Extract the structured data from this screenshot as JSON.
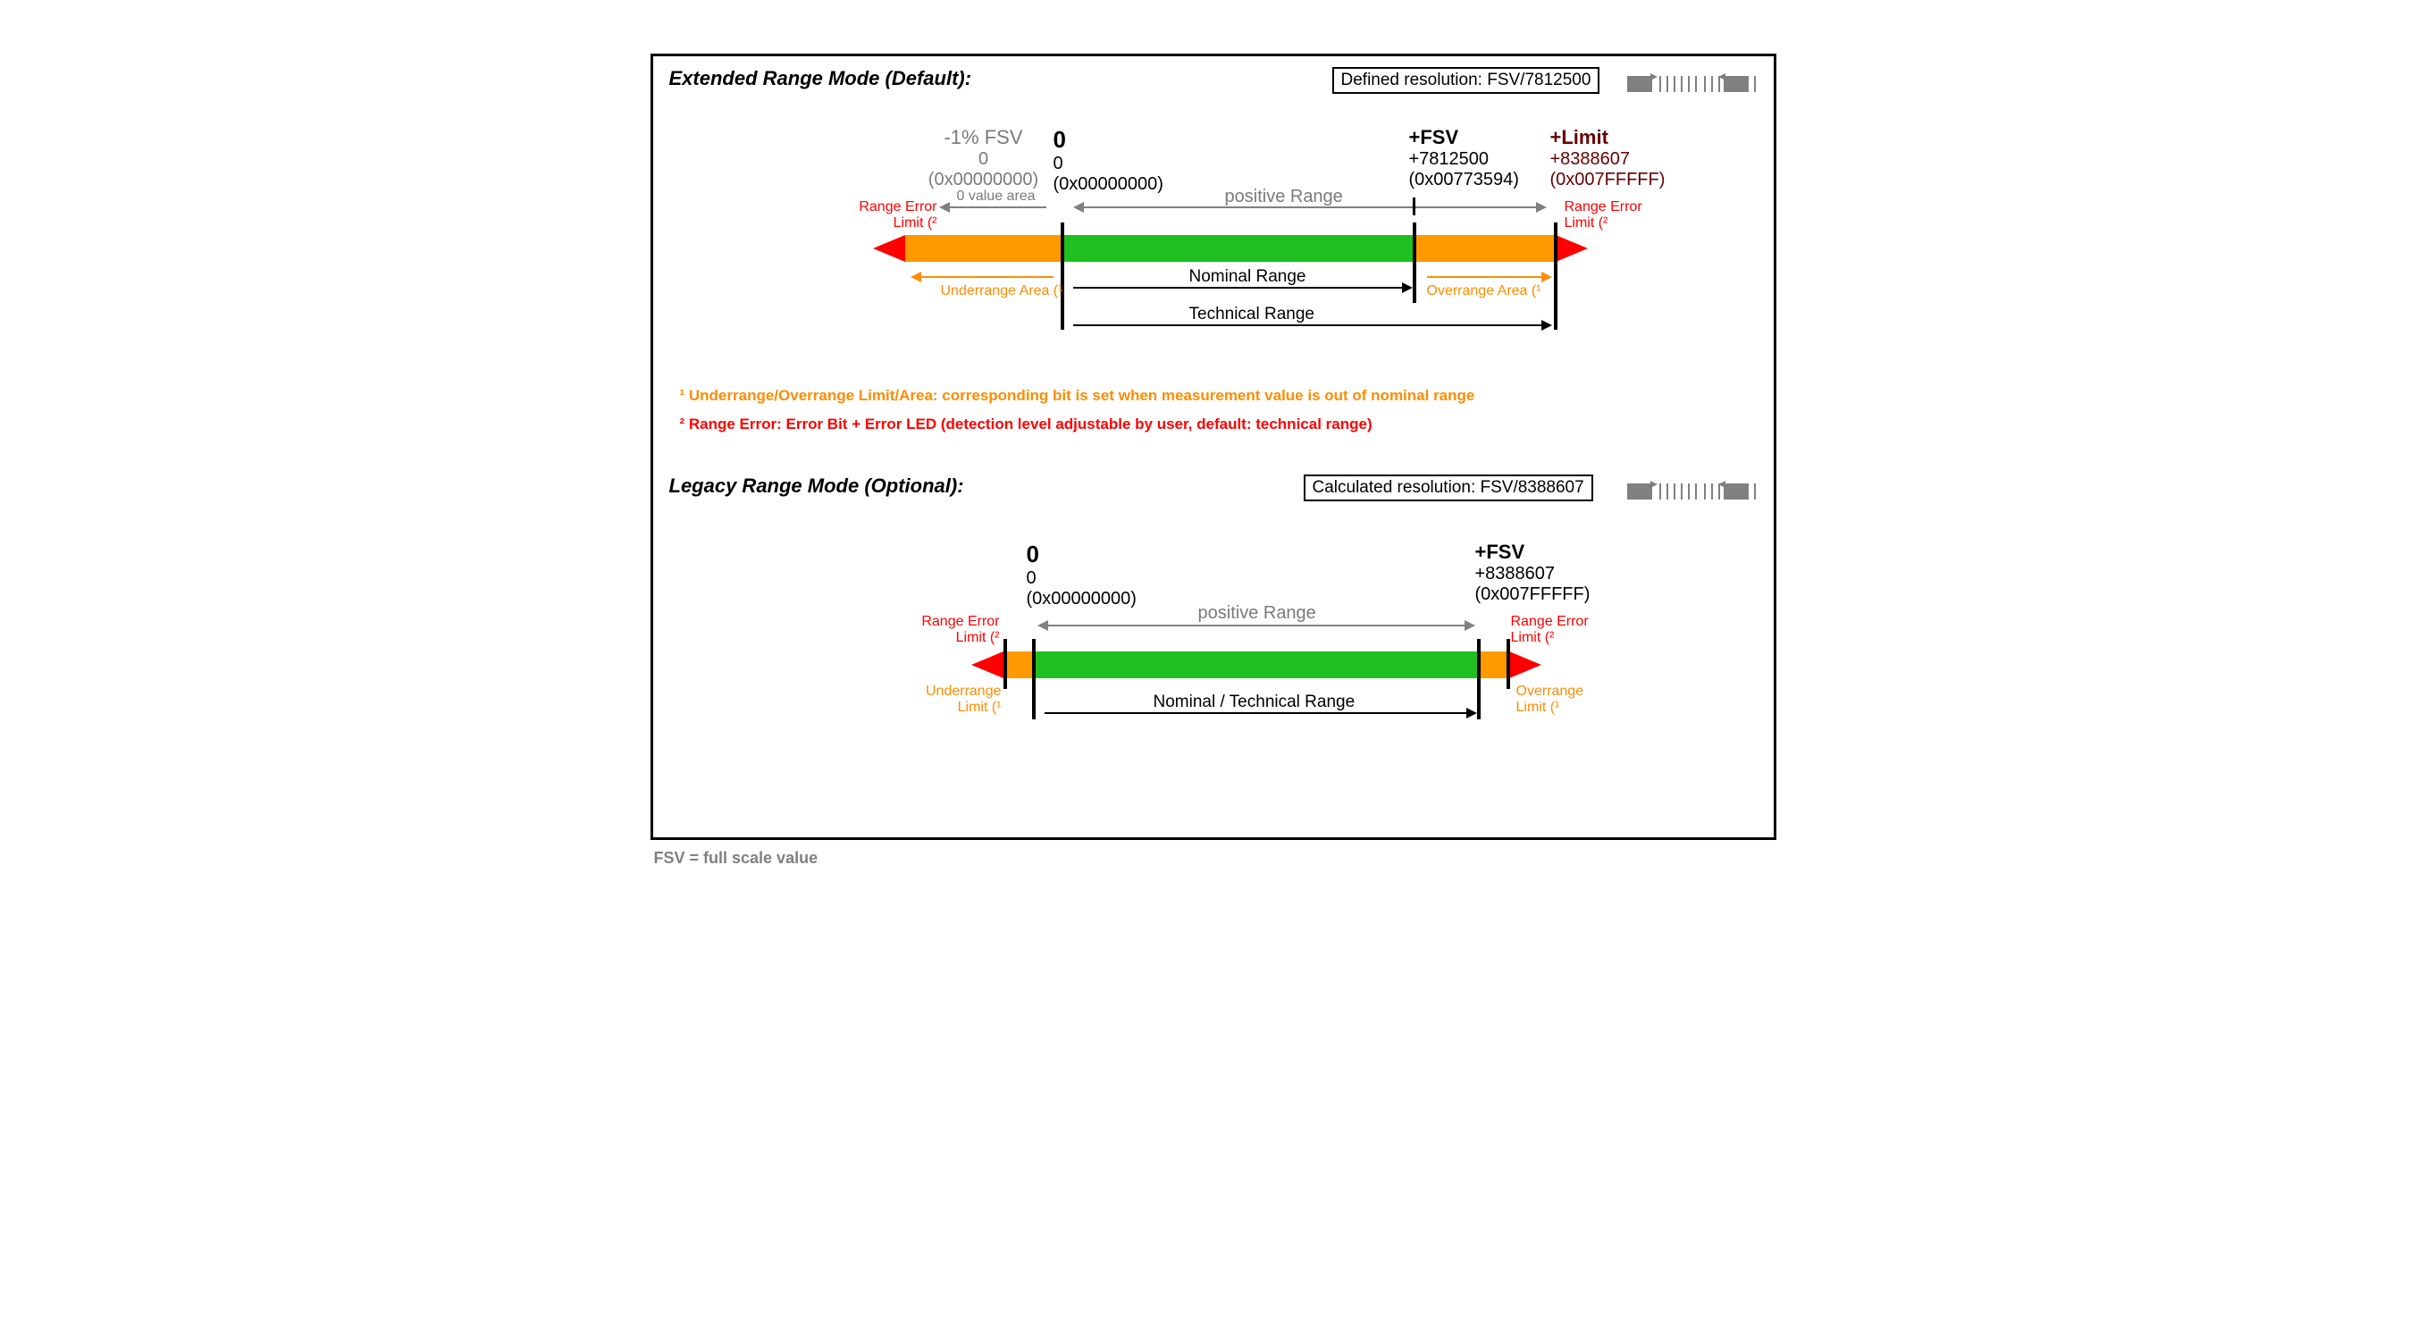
{
  "extended": {
    "title": "Extended Range Mode (Default):",
    "resolution_label": "Defined resolution: FSV/7812500",
    "marks": {
      "neg1": {
        "title": "-1% FSV",
        "num": "0",
        "hex": "(0x00000000)"
      },
      "zero": {
        "title": "0",
        "num": "0",
        "hex": "(0x00000000)"
      },
      "fsv": {
        "title": "+FSV",
        "num": "+7812500",
        "hex": "(0x00773594)"
      },
      "limit": {
        "title": "+Limit",
        "num": "+8388607",
        "hex": "(0x007FFFFF)"
      }
    },
    "zero_area_label": "0 value area",
    "positive_range_label": "positive Range",
    "nominal_label": "Nominal Range",
    "technical_label": "Technical Range",
    "underrange_label": "Underrange Area (¹",
    "overrange_label": "Overrange Area (¹",
    "range_error_label_l1": "Range Error",
    "range_error_label_l2": "Limit (²"
  },
  "footnotes": {
    "fn1": "¹ Underrange/Overrange Limit/Area: corresponding bit is set when measurement value is out of nominal range",
    "fn2": "² Range Error: Error Bit + Error LED (detection level adjustable by user, default: technical range)"
  },
  "legacy": {
    "title": "Legacy Range Mode (Optional):",
    "resolution_label": "Calculated resolution: FSV/8388607",
    "marks": {
      "zero": {
        "title": "0",
        "num": "0",
        "hex": "(0x00000000)"
      },
      "fsv": {
        "title": "+FSV",
        "num": "+8388607",
        "hex": "(0x007FFFFF)"
      }
    },
    "positive_range_label": "positive Range",
    "nominal_label": "Nominal / Technical Range",
    "underrange_label": "Underrange",
    "underrange_label2": "Limit (¹",
    "overrange_label": "Overrange",
    "overrange_label2": "Limit (¹",
    "range_error_label_l1": "Range Error",
    "range_error_label_l2": "Limit (²"
  },
  "caption": "FSV = full scale value"
}
